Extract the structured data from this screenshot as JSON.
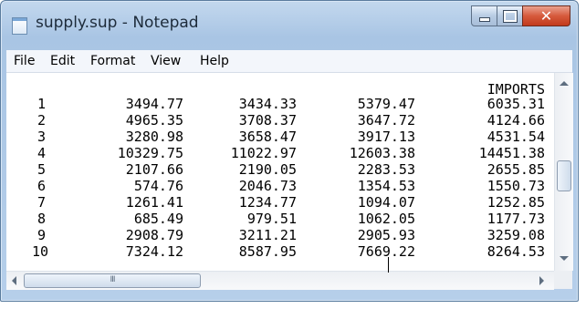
{
  "window": {
    "title": "supply.sup - Notepad",
    "icon": "notepad-icon"
  },
  "controls": {
    "minimize_icon": "minimize-icon",
    "maximize_icon": "maximize-icon",
    "close_glyph": "✕"
  },
  "menu": [
    "File",
    "Edit",
    "Format",
    "View",
    "Help"
  ],
  "content": {
    "header": "IMPORTS",
    "rows": [
      [
        "1",
        "3494.77",
        "3434.33",
        "5379.47",
        "6035.31"
      ],
      [
        "2",
        "4965.35",
        "3708.37",
        "3647.72",
        "4124.66"
      ],
      [
        "3",
        "3280.98",
        "3658.47",
        "3917.13",
        "4531.54"
      ],
      [
        "4",
        "10329.75",
        "11022.97",
        "12603.38",
        "14451.38"
      ],
      [
        "5",
        "2107.66",
        "2190.05",
        "2283.53",
        "2655.85"
      ],
      [
        "6",
        "574.76",
        "2046.73",
        "1354.53",
        "1550.73"
      ],
      [
        "7",
        "1261.41",
        "1234.77",
        "1094.07",
        "1252.85"
      ],
      [
        "8",
        "685.49",
        "979.51",
        "1062.05",
        "1177.73"
      ],
      [
        "9",
        "2908.79",
        "3211.21",
        "2905.93",
        "3259.08"
      ],
      [
        "10",
        "7324.12",
        "8587.95",
        "7669.22",
        "8264.53"
      ]
    ]
  },
  "scrollbars": {
    "horizontal_thumb_grip": "III"
  },
  "colors": {
    "title_bar": "#b6cfea",
    "close_button": "#c23a1d",
    "editor_background": "#ffffff"
  }
}
